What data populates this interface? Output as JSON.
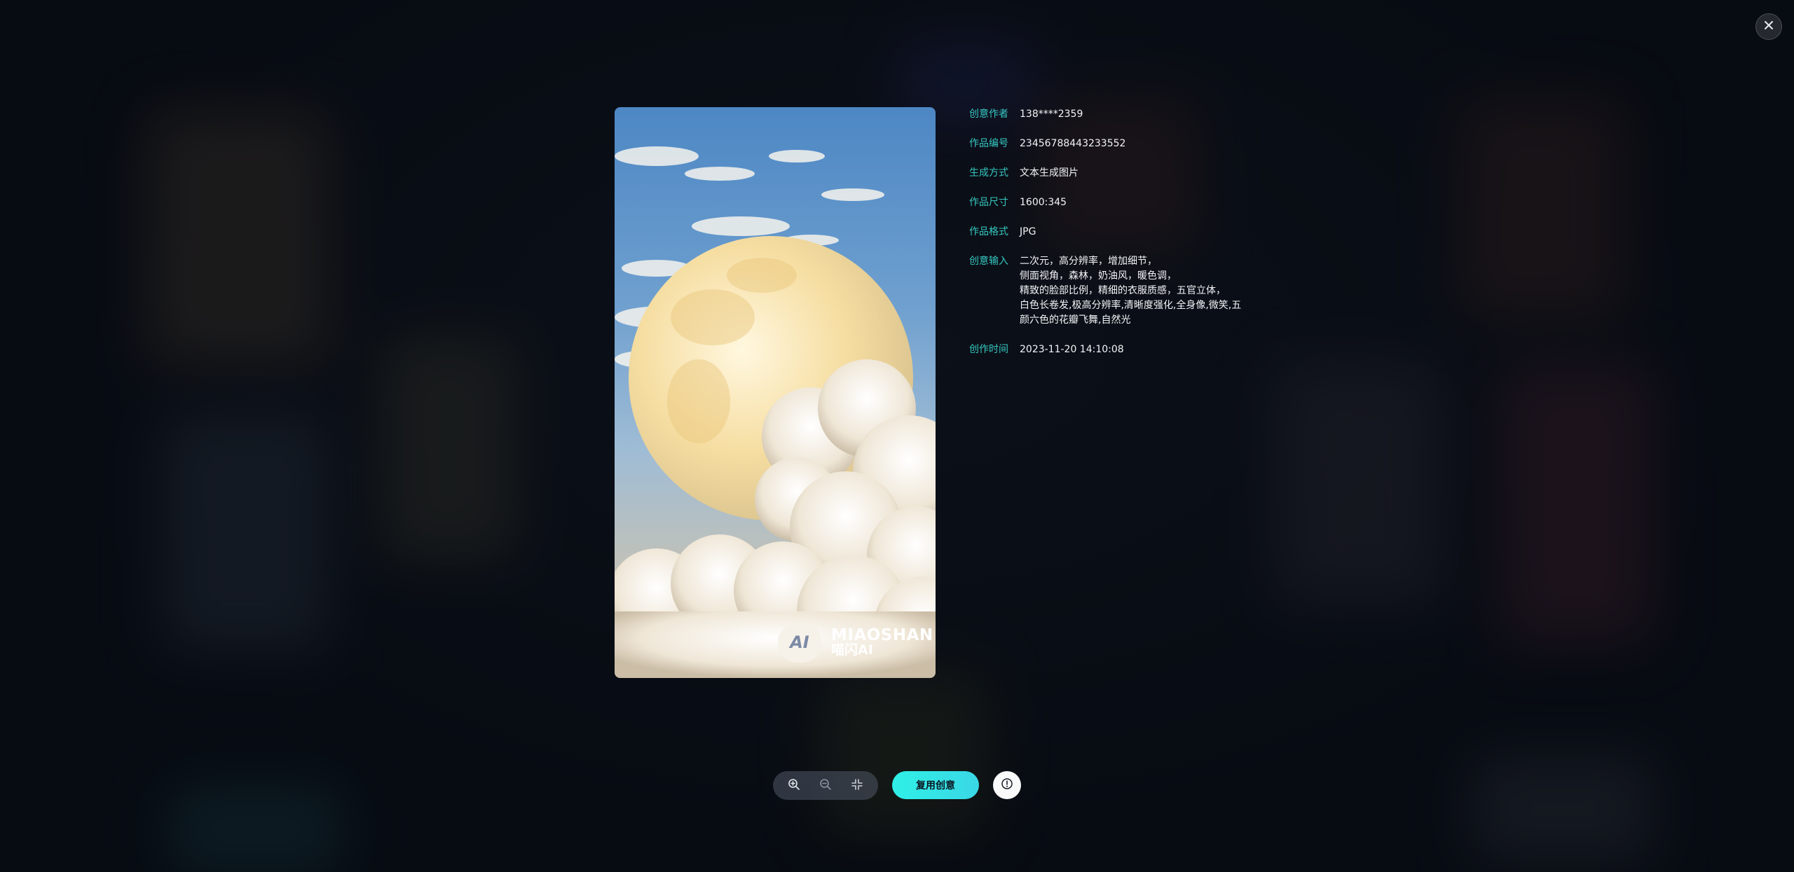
{
  "details": [
    {
      "label": "创意作者",
      "value": "138****2359"
    },
    {
      "label": "作品编号",
      "value": "23456788443233552"
    },
    {
      "label": "生成方式",
      "value": "文本生成图片"
    },
    {
      "label": "作品尺寸",
      "value": "1600:345"
    },
    {
      "label": "作品格式",
      "value": "JPG"
    },
    {
      "label": "创意输入",
      "value": "二次元，高分辨率，增加细节，\n侧面视角，森林，奶油风，暖色调，\n精致的脸部比例，精细的衣服质感，五官立体，\n白色长卷发,极高分辨率,清晰度强化,全身像,微笑,五\n颜六色的花瓣飞舞,自然光"
    },
    {
      "label": "创作时间",
      "value": "2023-11-20  14:10:08"
    }
  ],
  "watermark": {
    "badge_text": "AI",
    "brand": "MIAOSHAN",
    "brand_cn": "喵闪AI"
  },
  "actions": {
    "reuse_label": "复用创意"
  },
  "icons": {
    "close": "close-icon",
    "zoom_in": "zoom-in-icon",
    "zoom_out": "zoom-out-icon",
    "fit": "shrink-icon",
    "info": "info-icon"
  },
  "colors": {
    "accent": "#36c8c2",
    "button": "#2ff0e6"
  }
}
